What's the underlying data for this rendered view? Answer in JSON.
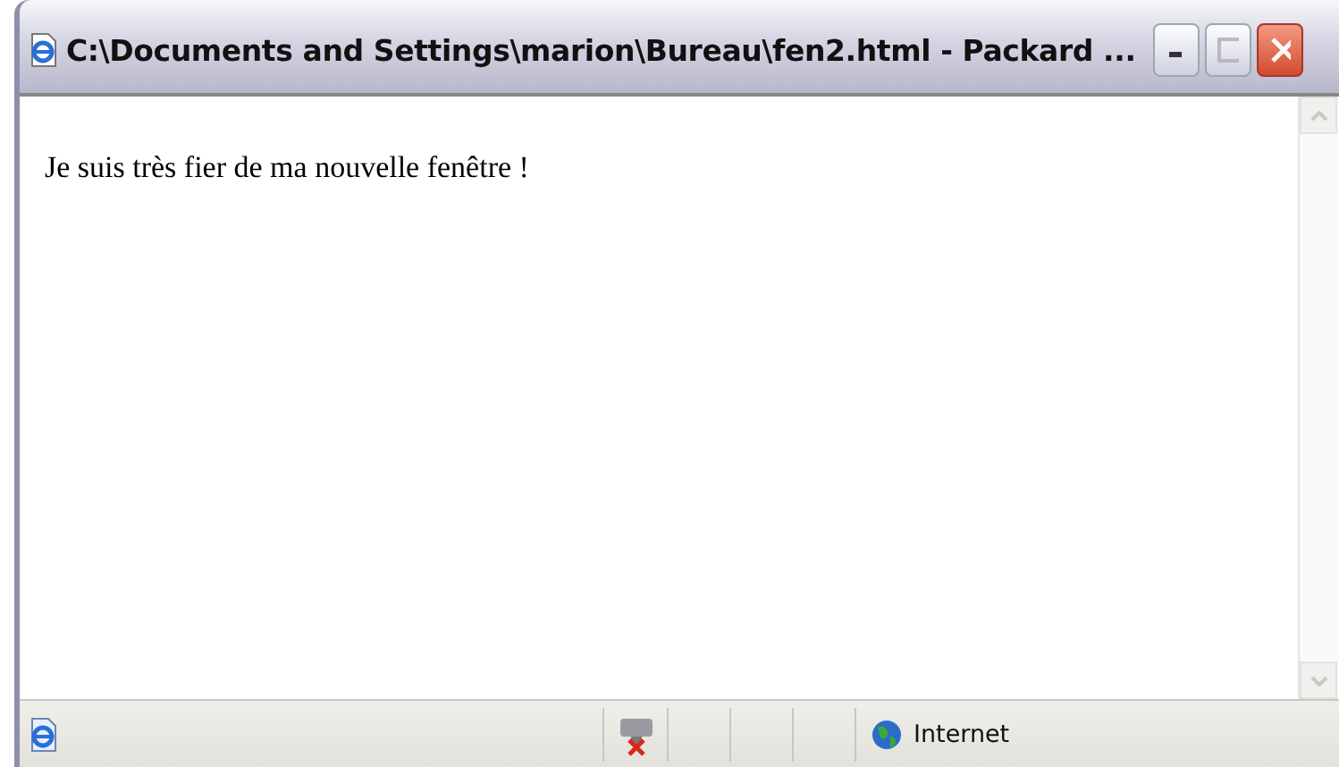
{
  "window": {
    "title": "C:\\Documents and Settings\\marion\\Bureau\\fen2.html - Packard ..."
  },
  "content": {
    "text": "Je suis très fier de ma nouvelle fenêtre !"
  },
  "status_bar": {
    "zone": "Internet"
  }
}
